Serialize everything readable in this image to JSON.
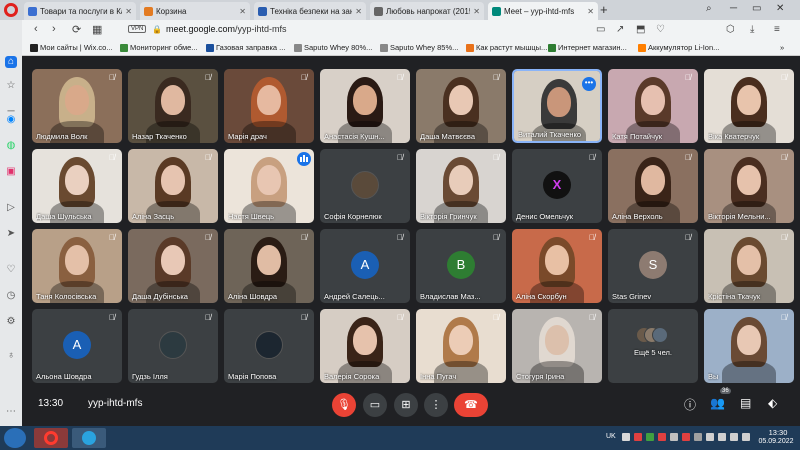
{
  "browser": {
    "tabs": [
      {
        "label": "Товари та послуги в Кам'я",
        "color": "#3b6fd1",
        "active": false
      },
      {
        "label": "Корзина",
        "color": "#e37b22",
        "active": false
      },
      {
        "label": "Техніка безпеки на занят",
        "color": "#2a5db0",
        "active": false
      },
      {
        "label": "Любовь напрокат (2015)",
        "color": "#666666",
        "active": false
      },
      {
        "label": "Meet – yyp-ihtd-mfs",
        "color": "#00897b",
        "active": true
      }
    ],
    "new_tab": "+",
    "vpn": "VPN",
    "url_domain": "meet.google.com",
    "url_path": "/yyp-ihtd-mfs",
    "bookmarks": [
      {
        "label": "Мои сайты | Wix.co...",
        "color": "#222222"
      },
      {
        "label": "Мониторинг обме...",
        "color": "#3a8a3a"
      },
      {
        "label": "Газовая заправка ...",
        "color": "#1a4f9c"
      },
      {
        "label": "Saputo Whey 80%...",
        "color": "#888888"
      },
      {
        "label": "Saputo Whey 85%...",
        "color": "#888888"
      },
      {
        "label": "Как растут мышцы...",
        "color": "#e8711a"
      },
      {
        "label": "Интернет магазин...",
        "color": "#2e7d32"
      },
      {
        "label": "Аккумулятор Li-Ion...",
        "color": "#ff7f00"
      }
    ],
    "bookmarks_more": "»"
  },
  "participants": [
    {
      "name": "Людмила Волк",
      "kind": "video",
      "bg": "#8b6f5a",
      "skin": "#d9a98a",
      "hair": "#c8b08a"
    },
    {
      "name": "Назар Ткаченко",
      "kind": "video",
      "bg": "#5a5040",
      "skin": "#e0b8a0",
      "hair": "#3a2a20"
    },
    {
      "name": "Марія драч",
      "kind": "video",
      "bg": "#6a4a3a",
      "skin": "#e6b9a0",
      "hair": "#b05a30"
    },
    {
      "name": "Анастасія Кушн...",
      "kind": "video",
      "bg": "#d8d0c8",
      "skin": "#d9a98a",
      "hair": "#2a1a14"
    },
    {
      "name": "Даша Матвєєва",
      "kind": "video",
      "bg": "#8a7a6a",
      "skin": "#e8c8b4",
      "hair": "#4a3020"
    },
    {
      "name": "Виталий Ткаченко",
      "kind": "video",
      "bg": "#d6cfc4",
      "skin": "#c9967a",
      "hair": "#3a3a3a",
      "speaking": true,
      "more": true
    },
    {
      "name": "Катя Потайчук",
      "kind": "video",
      "bg": "#c8a8b0",
      "skin": "#e6c0b0",
      "hair": "#5a3a2a"
    },
    {
      "name": "Віка Кватерчук",
      "kind": "video",
      "bg": "#e4ded6",
      "skin": "#e8c4ac",
      "hair": "#4a2e1e"
    },
    {
      "name": "Даша Шульська",
      "kind": "video",
      "bg": "#e6e2dc",
      "skin": "#ead0c0",
      "hair": "#6a4a30"
    },
    {
      "name": "Аліна Засць",
      "kind": "video",
      "bg": "#c8b8a8",
      "skin": "#e6c4b0",
      "hair": "#5a3a24"
    },
    {
      "name": "Настя Швець",
      "kind": "video",
      "bg": "#ece4da",
      "skin": "#e8c6b2",
      "hair": "#c8a080",
      "audio": true
    },
    {
      "name": "Софія Корнелюк",
      "kind": "image",
      "bg": "#3c4043",
      "avatar_color": "#5a4a3a"
    },
    {
      "name": "Вікторія Гринчук",
      "kind": "video",
      "bg": "#d8d4d0",
      "skin": "#e8ccba",
      "hair": "#6a4a34"
    },
    {
      "name": "Денис Омельчук",
      "kind": "letter",
      "letter": "X",
      "avatar_color": "#111111",
      "letter_color": "#d23cf0"
    },
    {
      "name": "Аліна Верхоль",
      "kind": "video",
      "bg": "#8a7060",
      "skin": "#e0b8a0",
      "hair": "#3a2418"
    },
    {
      "name": "Вікторія Мельни...",
      "kind": "video",
      "bg": "#a89080",
      "skin": "#e6c2ac",
      "hair": "#4a2e20"
    },
    {
      "name": "Таня Колосівська",
      "kind": "video",
      "bg": "#b8a088",
      "skin": "#e4c0a8",
      "hair": "#8a6040"
    },
    {
      "name": "Даша Дубінська",
      "kind": "video",
      "bg": "#7a6a5e",
      "skin": "#e8c8b6",
      "hair": "#5a3a28"
    },
    {
      "name": "Аліна Шовдра",
      "kind": "video",
      "bg": "#6e6458",
      "skin": "#e0bca4",
      "hair": "#2a1c14"
    },
    {
      "name": "Андрей Салець...",
      "kind": "letter",
      "letter": "A",
      "avatar_color": "#1a5fb4"
    },
    {
      "name": "Владислав Маз...",
      "kind": "letter",
      "letter": "B",
      "avatar_color": "#2e7d32"
    },
    {
      "name": "Аліна Скорбун",
      "kind": "video",
      "bg": "#c86a4a",
      "skin": "#e8c0a4",
      "hair": "#7a4a2a"
    },
    {
      "name": "Stas Grinev",
      "kind": "letter",
      "letter": "S",
      "avatar_color": "#8d7b71"
    },
    {
      "name": "Крістіна Ткачук",
      "kind": "video",
      "bg": "#c8c0b4",
      "skin": "#e4c0a8",
      "hair": "#6a4a30"
    },
    {
      "name": "Альона Шовдра",
      "kind": "letter",
      "letter": "A",
      "avatar_color": "#1a5fb4"
    },
    {
      "name": "Гудзь Ілля",
      "kind": "image",
      "bg": "#3c4043",
      "avatar_color": "#2c3a40"
    },
    {
      "name": "Марія Попова",
      "kind": "image",
      "bg": "#3c4043",
      "avatar_color": "#1c2630"
    },
    {
      "name": "Валерія Сорока",
      "kind": "video",
      "bg": "#d6cdc4",
      "skin": "#e6c2ac",
      "hair": "#3a2418"
    },
    {
      "name": "Інна Пугач",
      "kind": "video",
      "bg": "#e8ddd0",
      "skin": "#ecccb6",
      "hair": "#b07a4a"
    },
    {
      "name": "Стогуря Ірина",
      "kind": "video",
      "bg": "#b8b4b0",
      "skin": "#dcc0ac",
      "hair": "#e0d8d0"
    },
    {
      "name": "Ещё 5 чел.",
      "kind": "others",
      "bg": "#3c4043"
    },
    {
      "name": "Вы",
      "kind": "video",
      "bg": "#9cb0c8",
      "skin": "#e8c8b4",
      "hair": "#6a4a34"
    }
  ],
  "toolbar": {
    "time": "13:30",
    "meeting_code": "yyp-ihtd-mfs",
    "people_count": "36"
  },
  "taskbar": {
    "lang": "UK",
    "time": "13:30",
    "date": "05.09.2022"
  }
}
